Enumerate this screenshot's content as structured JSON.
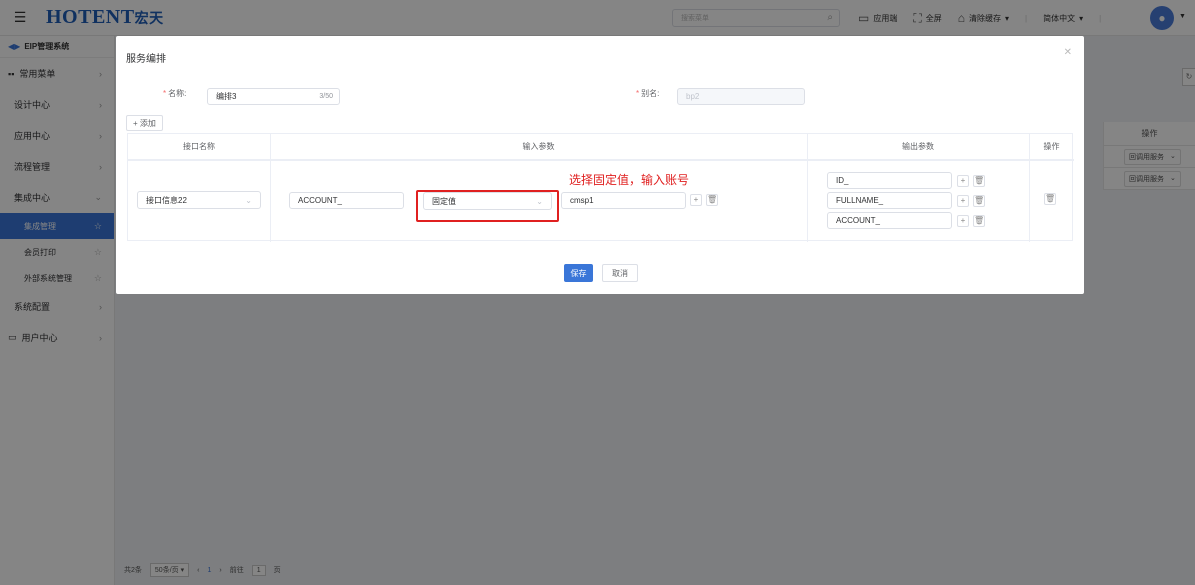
{
  "header": {
    "logo_text": "HOTENT",
    "logo_cn": "宏天",
    "search_placeholder": "搜索菜单",
    "actions": [
      {
        "icon": "monitor-icon",
        "label": "应用端"
      },
      {
        "icon": "fullscreen-icon",
        "label": "全屏"
      },
      {
        "icon": "broom-icon",
        "label": "清除缓存"
      }
    ],
    "language": "简体中文"
  },
  "sidebar": {
    "system_title": "EIP管理系统",
    "items": [
      {
        "label": "常用菜单"
      },
      {
        "label": "设计中心"
      },
      {
        "label": "应用中心"
      },
      {
        "label": "流程管理"
      },
      {
        "label": "集成中心"
      }
    ],
    "sub_items": [
      {
        "label": "集成管理",
        "active": true
      },
      {
        "label": "会员打印"
      },
      {
        "label": "外部系统管理"
      }
    ],
    "bottom_items": [
      {
        "label": "系统配置"
      },
      {
        "label": "用户中心"
      }
    ]
  },
  "background_table": {
    "header_action": "操作",
    "rows": [
      {
        "action": "回调用服务"
      },
      {
        "action": "回调用服务"
      }
    ]
  },
  "pagination": {
    "total": "共2条",
    "page_size": "50条/页",
    "current_page": "1",
    "goto_label": "前往",
    "goto_value": "1",
    "page_unit": "页"
  },
  "dialog": {
    "title": "服务编排",
    "name_label": "名称:",
    "name_value": "编排3",
    "name_count": "3/50",
    "alias_label": "别名:",
    "alias_value": "bp2",
    "add_label": "+ 添加",
    "columns": [
      "接口名称",
      "输入参数",
      "输出参数",
      "操作"
    ],
    "row": {
      "interface": "接口信息22",
      "input_param": "ACCOUNT_",
      "input_type": "固定值",
      "input_value": "cmsp1",
      "outputs": [
        "ID_",
        "FULLNAME_",
        "ACCOUNT_"
      ]
    },
    "annotation": "选择固定值，输入账号",
    "save_label": "保存",
    "cancel_label": "取消"
  },
  "colors": {
    "primary": "#3a76d8",
    "annotation_red": "#e02020",
    "overlay": "rgba(0,0,0,0.48)"
  }
}
